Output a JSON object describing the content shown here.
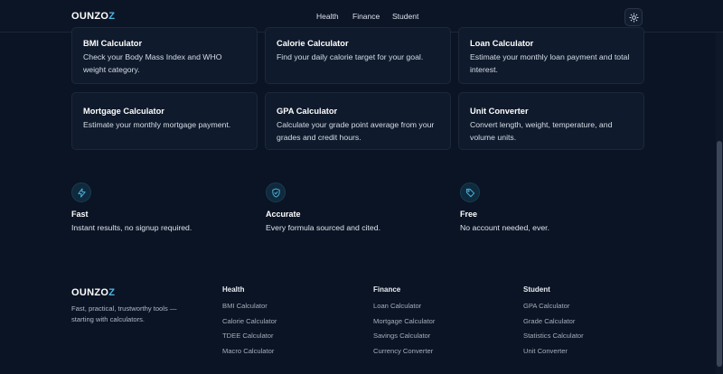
{
  "brand": {
    "logo_main": "OUNZO",
    "logo_accent": "Z"
  },
  "header": {
    "nav": [
      "Health",
      "Finance",
      "Student"
    ],
    "theme_toggle_icon": "sun-icon"
  },
  "calculators": [
    {
      "title": "BMI Calculator",
      "desc": "Check your Body Mass Index and WHO weight category."
    },
    {
      "title": "Calorie Calculator",
      "desc": "Find your daily calorie target for your goal."
    },
    {
      "title": "Loan Calculator",
      "desc": "Estimate your monthly loan payment and total interest."
    },
    {
      "title": "Mortgage Calculator",
      "desc": "Estimate your monthly mortgage payment."
    },
    {
      "title": "GPA Calculator",
      "desc": "Calculate your grade point average from your grades and credit hours."
    },
    {
      "title": "Unit Converter",
      "desc": "Convert length, weight, temperature, and volume units."
    }
  ],
  "features": [
    {
      "icon": "lightning-icon",
      "title": "Fast",
      "desc": "Instant results, no signup required."
    },
    {
      "icon": "shield-check-icon",
      "title": "Accurate",
      "desc": "Every formula sourced and cited."
    },
    {
      "icon": "tag-icon",
      "title": "Free",
      "desc": "No account needed, ever."
    }
  ],
  "footer": {
    "tagline": "Fast, practical, trustworthy tools — starting with calculators.",
    "columns": [
      {
        "heading": "Health",
        "links": [
          "BMI Calculator",
          "Calorie Calculator",
          "TDEE Calculator",
          "Macro Calculator"
        ]
      },
      {
        "heading": "Finance",
        "links": [
          "Loan Calculator",
          "Mortgage Calculator",
          "Savings Calculator",
          "Currency Converter"
        ]
      },
      {
        "heading": "Student",
        "links": [
          "GPA Calculator",
          "Grade Calculator",
          "Statistics Calculator",
          "Unit Converter"
        ]
      }
    ]
  },
  "colors": {
    "background": "#0b1424",
    "card": "#0f1a2c",
    "accent": "#4fb7e6"
  }
}
